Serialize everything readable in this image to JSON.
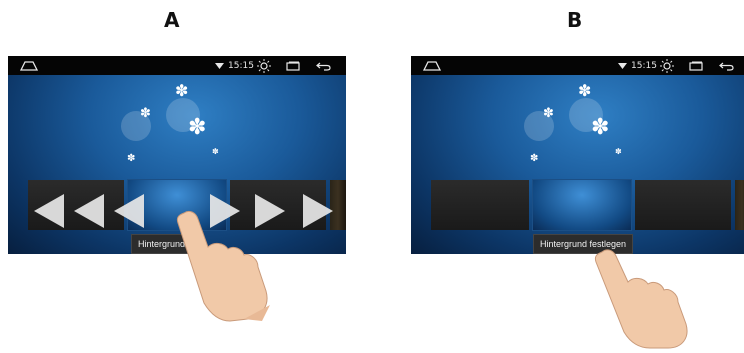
{
  "panels": [
    {
      "label": "A",
      "button_label": "Hintergrund fe",
      "time": "15:15"
    },
    {
      "label": "B",
      "button_label": "Hintergrund festlegen",
      "time": "15:15"
    }
  ],
  "icons": [
    "home-icon",
    "wifi-icon",
    "brightness-icon",
    "recent-apps-icon",
    "back-icon",
    "fish-icon",
    "swipe-left-arrow-icon",
    "swipe-right-arrow-icon",
    "hand-pointer-icon"
  ],
  "colors": {
    "statusbar": "#050505",
    "screen_blue": "#1a5a9a",
    "arrow": "#e6e6e6",
    "skin": "#f1c9a8"
  }
}
